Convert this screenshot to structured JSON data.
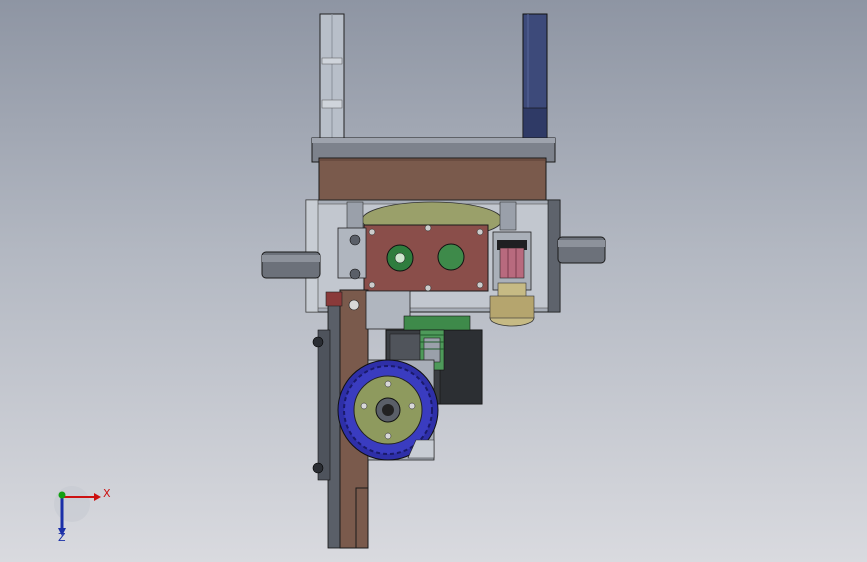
{
  "triad": {
    "x_label": "X",
    "z_label": "Z",
    "x_color": "#cc1111",
    "y_color": "#12a012",
    "z_color": "#1a2fa8"
  },
  "colors": {
    "steel": "#b4bac4",
    "dark_steel": "#6b707a",
    "brown_plate": "#7a5a4c",
    "maroon_block": "#8a4e4a",
    "green_gear": "#3e8a4a",
    "olive_disk": "#8e9a5e",
    "navy_wheel": "#3a3cc0",
    "navy_post": "#3d4a7a",
    "dark_plate": "#3a3d42"
  }
}
